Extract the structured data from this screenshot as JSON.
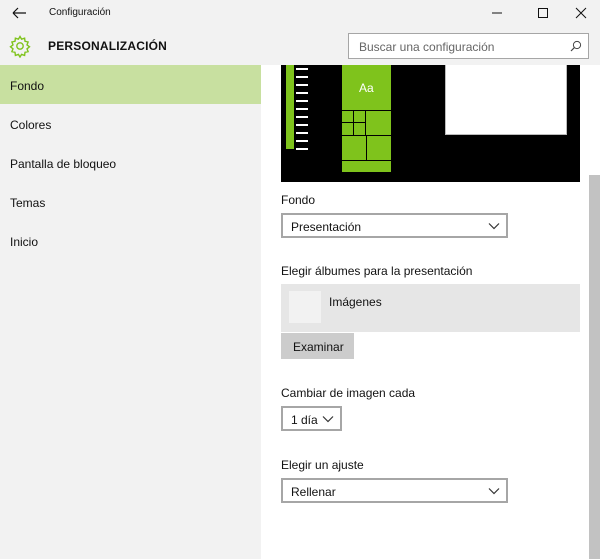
{
  "window": {
    "title": "Configuración"
  },
  "header": {
    "section_title": "PERSONALIZACIÓN",
    "search_placeholder": "Buscar una configuración"
  },
  "sidebar": {
    "items": [
      {
        "label": "Fondo",
        "active": true
      },
      {
        "label": "Colores",
        "active": false
      },
      {
        "label": "Pantalla de bloqueo",
        "active": false
      },
      {
        "label": "Temas",
        "active": false
      },
      {
        "label": "Inicio",
        "active": false
      }
    ]
  },
  "preview": {
    "tile_text": "Aa"
  },
  "background": {
    "label": "Fondo",
    "value": "Presentación"
  },
  "albums": {
    "label": "Elegir álbumes para la presentación",
    "album_name": "Imágenes",
    "browse_label": "Examinar"
  },
  "interval": {
    "label": "Cambiar de imagen cada",
    "value": "1 día"
  },
  "fit": {
    "label": "Elegir un ajuste",
    "value": "Rellenar"
  },
  "colors": {
    "accent": "#7fc31c",
    "sidebar_active": "#c8e0a0",
    "chrome": "#f2f2f2"
  },
  "icons": [
    "back-arrow-icon",
    "minimize-icon",
    "maximize-icon",
    "close-icon",
    "gear-icon",
    "search-icon",
    "chevron-down-icon"
  ]
}
